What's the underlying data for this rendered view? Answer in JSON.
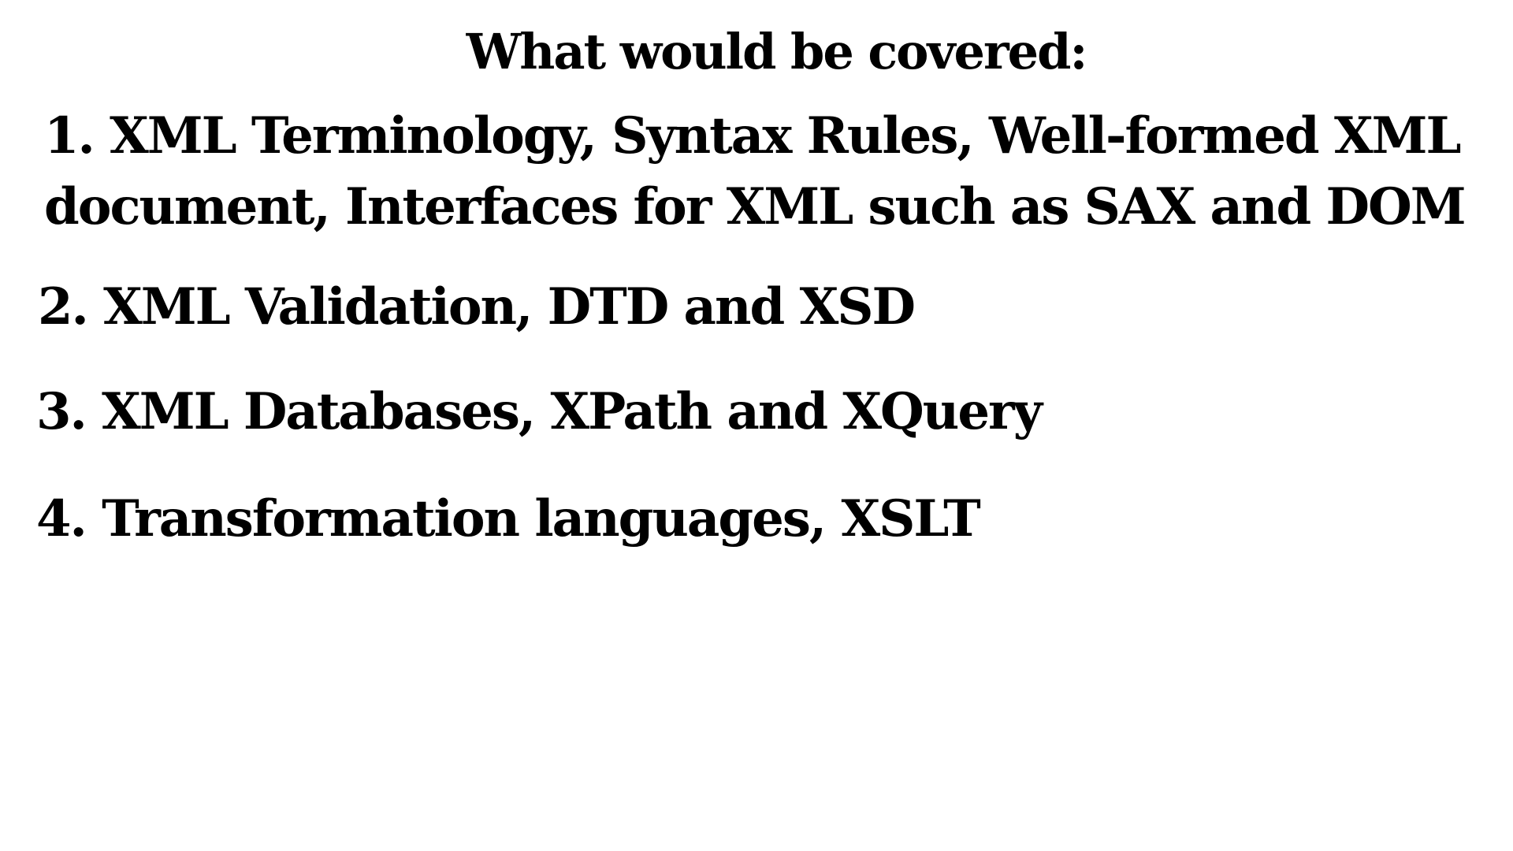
{
  "slide": {
    "title": "What would be covered:",
    "items": [
      {
        "line1": "1. XML Terminology, Syntax Rules, Well-formed XML",
        "line2": "document, Interfaces for XML such as SAX and DOM"
      },
      {
        "text": "2. XML Validation, DTD and XSD"
      },
      {
        "text": "3. XML Databases, XPath and XQuery"
      },
      {
        "text": "4. Transformation languages, XSLT"
      }
    ]
  },
  "colors": {
    "background": "#ffffff",
    "text": "#000000"
  }
}
